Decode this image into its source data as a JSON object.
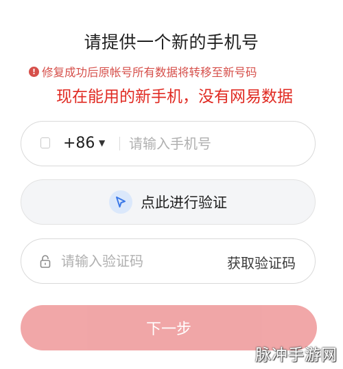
{
  "page": {
    "title": "请提供一个新的手机号",
    "warning_text": "修复成功后原帐号所有数据将转移至新号码"
  },
  "annotation": {
    "text": "现在能用的新手机，没有网易数据"
  },
  "phone_field": {
    "country_code": "+86",
    "placeholder": "请输入手机号",
    "value": ""
  },
  "verify_button": {
    "label": "点此进行验证"
  },
  "code_field": {
    "placeholder": "请输入验证码",
    "value": "",
    "get_code_label": "获取验证码"
  },
  "next_button": {
    "label": "下一步"
  },
  "watermark": {
    "text": "脉冲手游网"
  },
  "colors": {
    "warning": "#d6504b",
    "annotation": "#e02a22",
    "next_button_bg": "#f0a2a3",
    "verify_icon_bg": "#dbe8fb",
    "verify_icon_fg": "#3b78e7"
  },
  "icons": {
    "warning": "exclamation-circle-icon",
    "verify": "cursor-pointer-icon",
    "lock": "lock-icon",
    "caret": "chevron-down-icon"
  }
}
